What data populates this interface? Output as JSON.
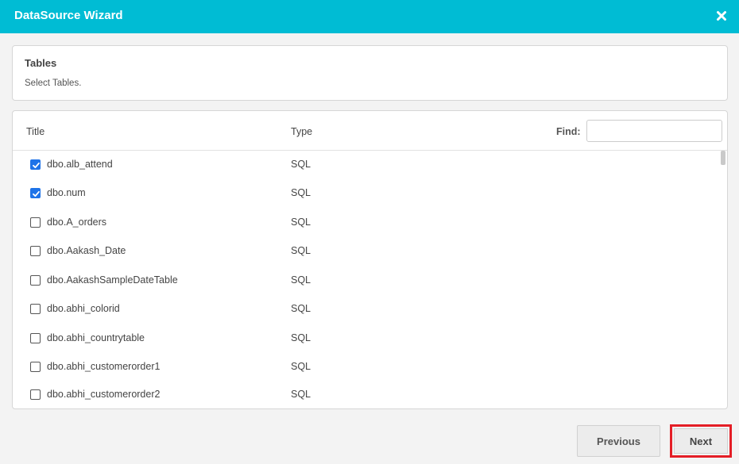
{
  "window": {
    "title": "DataSource Wizard",
    "close_icon": "close-icon"
  },
  "header": {
    "title": "Tables",
    "subtitle": "Select Tables."
  },
  "table": {
    "columns": {
      "title": "Title",
      "type": "Type"
    },
    "find_label": "Find:",
    "find_value": "",
    "rows": [
      {
        "name": "dbo.alb_attend",
        "type": "SQL",
        "checked": true
      },
      {
        "name": "dbo.num",
        "type": "SQL",
        "checked": true
      },
      {
        "name": "dbo.A_orders",
        "type": "SQL",
        "checked": false
      },
      {
        "name": "dbo.Aakash_Date",
        "type": "SQL",
        "checked": false
      },
      {
        "name": "dbo.AakashSampleDateTable",
        "type": "SQL",
        "checked": false
      },
      {
        "name": "dbo.abhi_colorid",
        "type": "SQL",
        "checked": false
      },
      {
        "name": "dbo.abhi_countrytable",
        "type": "SQL",
        "checked": false
      },
      {
        "name": "dbo.abhi_customerorder1",
        "type": "SQL",
        "checked": false
      },
      {
        "name": "dbo.abhi_customerorder2",
        "type": "SQL",
        "checked": false
      }
    ]
  },
  "footer": {
    "previous_label": "Previous",
    "next_label": "Next"
  },
  "colors": {
    "titlebar": "#00bcd4",
    "checkbox_checked": "#1e73e8",
    "highlight": "#e41e26"
  }
}
